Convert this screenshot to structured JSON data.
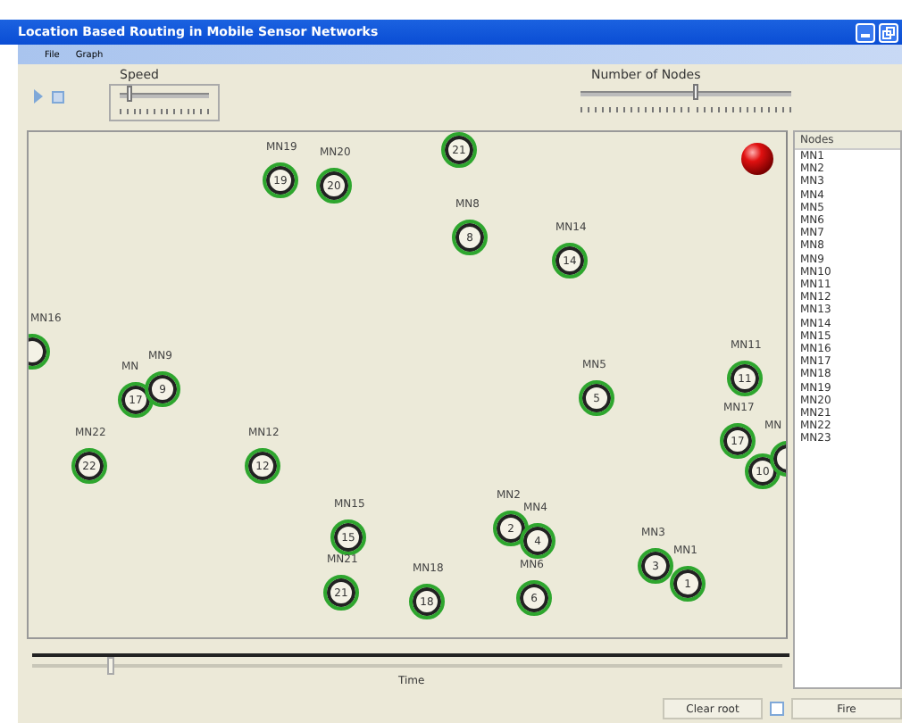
{
  "window": {
    "title": "Location Based Routing in Mobile Sensor Networks"
  },
  "menu": [
    "File",
    "Graph"
  ],
  "speed": {
    "label": "Speed",
    "level": 0.1
  },
  "node_count": {
    "label": "Number of Nodes",
    "level": 0.54
  },
  "nodes": [
    {
      "label": "MN19",
      "number": "19"
    },
    {
      "label": "MN20",
      "number": "20"
    },
    {
      "number": "21"
    },
    {
      "label": "MN8",
      "number": "8"
    },
    {
      "label": "MN14",
      "number": "14"
    },
    {
      "label": "MN16"
    },
    {
      "label": "MN",
      "number": "17"
    },
    {
      "label": "MN9",
      "number": "9"
    },
    {
      "label": "MN5",
      "number": "5"
    },
    {
      "label": "MN11",
      "number": "11"
    },
    {
      "label": "MN17",
      "number": "17"
    },
    {
      "number": "10"
    },
    {
      "label": "MN"
    },
    {
      "label": "MN22",
      "number": "22"
    },
    {
      "label": "MN12",
      "number": "12"
    },
    {
      "label": "MN15",
      "number": "15"
    },
    {
      "label": "MN21",
      "number": "21"
    },
    {
      "label": "MN18",
      "number": "18"
    },
    {
      "label": "MN2",
      "number": "2"
    },
    {
      "label": "MN4",
      "number": "4"
    },
    {
      "label": "MN6",
      "number": "6"
    },
    {
      "label": "MN3",
      "number": "3"
    },
    {
      "label": "MN1",
      "number": "1"
    }
  ],
  "time": {
    "label": "Time",
    "level": 0.1
  },
  "node_list": {
    "heading": "Nodes",
    "items": [
      "MN1",
      "MN2",
      "MN3",
      "MN4",
      "MN5",
      "MN6",
      "MN7",
      "MN8",
      "MN9",
      "MN10",
      "MN11",
      "MN12",
      "MN13",
      "MN14",
      "MN15",
      "MN16",
      "MN17",
      "MN18",
      "MN19",
      "MN20",
      "MN21",
      "MN22",
      "MN23"
    ]
  },
  "buttons": {
    "clear": "Clear root",
    "fire": "Fire",
    "checked": false
  }
}
